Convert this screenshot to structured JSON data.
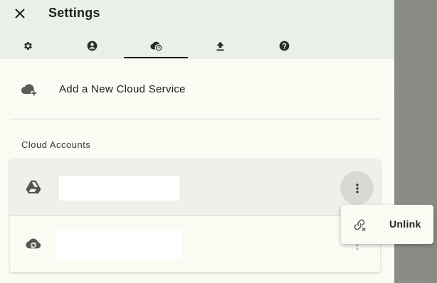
{
  "settings": {
    "title": "Settings",
    "tabs": [
      {
        "icon": "gear-icon",
        "active": false
      },
      {
        "icon": "account-circle-icon",
        "active": false
      },
      {
        "icon": "cloud-sync-icon",
        "active": true
      },
      {
        "icon": "upload-icon",
        "active": false
      },
      {
        "icon": "help-icon",
        "active": false
      }
    ]
  },
  "cloud": {
    "add_service_label": "Add a New Cloud Service",
    "section_label": "Cloud Accounts",
    "accounts": [
      {
        "icon": "google-drive-icon",
        "name": ""
      },
      {
        "icon": "cloud-sync-icon",
        "name": ""
      }
    ]
  },
  "menu": {
    "unlink_label": "Unlink",
    "unlink_icon": "unlink-icon"
  },
  "colors": {
    "header_bg": "#e9f0e7",
    "panel_bg": "#fafbf3",
    "icon": "#2b2b2b",
    "backdrop": "#8e8e8a"
  }
}
